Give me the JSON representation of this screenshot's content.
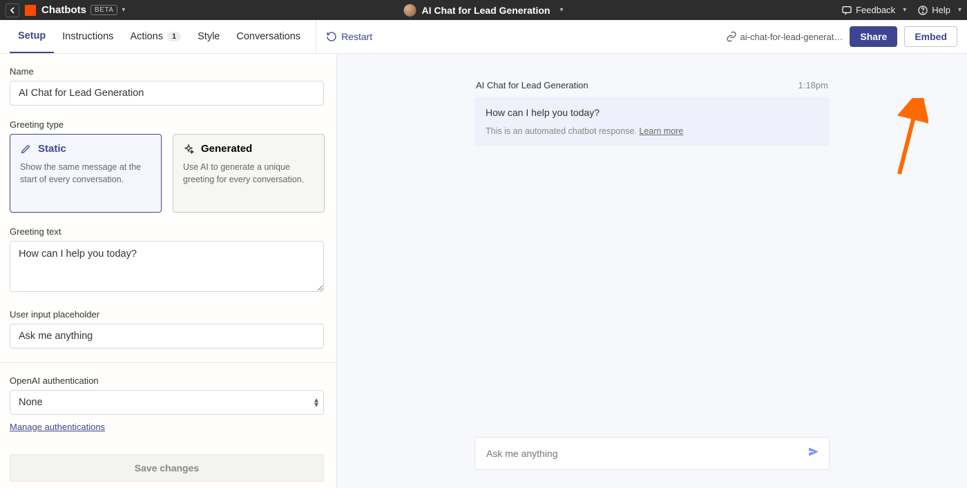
{
  "topbar": {
    "product": "Chatbots",
    "badge": "BETA",
    "title": "AI Chat for Lead Generation",
    "feedback": "Feedback",
    "help": "Help"
  },
  "tabs": {
    "setup": "Setup",
    "instructions": "Instructions",
    "actions": "Actions",
    "actions_count": "1",
    "style": "Style",
    "conversations": "Conversations",
    "restart": "Restart",
    "slug": "ai-chat-for-lead-generat…",
    "share": "Share",
    "embed": "Embed"
  },
  "form": {
    "name_label": "Name",
    "name_value": "AI Chat for Lead Generation",
    "greeting_type_label": "Greeting type",
    "static": {
      "title": "Static",
      "desc": "Show the same message at the start of every conversation."
    },
    "generated": {
      "title": "Generated",
      "desc": "Use AI to generate a unique greeting for every conversation."
    },
    "greeting_text_label": "Greeting text",
    "greeting_text_value": "How can I help you today?",
    "placeholder_label": "User input placeholder",
    "placeholder_value": "Ask me anything",
    "openai_label": "OpenAI authentication",
    "openai_value": "None",
    "manage_auth": "Manage authentications",
    "save": "Save changes"
  },
  "chat": {
    "title": "AI Chat for Lead Generation",
    "time": "1:18pm",
    "question": "How can I help you today?",
    "note_prefix": "This is an automated chatbot response. ",
    "note_link": "Learn more",
    "input_placeholder": "Ask me anything"
  }
}
